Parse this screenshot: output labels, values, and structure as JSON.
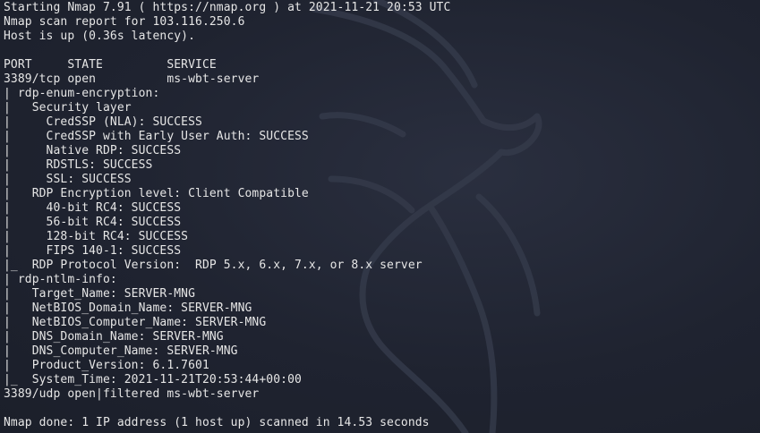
{
  "terminal": {
    "lines": [
      "Starting Nmap 7.91 ( https://nmap.org ) at 2021-11-21 20:53 UTC",
      "Nmap scan report for 103.116.250.6",
      "Host is up (0.36s latency).",
      "",
      "PORT     STATE         SERVICE",
      "3389/tcp open          ms-wbt-server",
      "| rdp-enum-encryption:",
      "|   Security layer",
      "|     CredSSP (NLA): SUCCESS",
      "|     CredSSP with Early User Auth: SUCCESS",
      "|     Native RDP: SUCCESS",
      "|     RDSTLS: SUCCESS",
      "|     SSL: SUCCESS",
      "|   RDP Encryption level: Client Compatible",
      "|     40-bit RC4: SUCCESS",
      "|     56-bit RC4: SUCCESS",
      "|     128-bit RC4: SUCCESS",
      "|     FIPS 140-1: SUCCESS",
      "|_  RDP Protocol Version:  RDP 5.x, 6.x, 7.x, or 8.x server",
      "| rdp-ntlm-info:",
      "|   Target_Name: SERVER-MNG",
      "|   NetBIOS_Domain_Name: SERVER-MNG",
      "|   NetBIOS_Computer_Name: SERVER-MNG",
      "|   DNS_Domain_Name: SERVER-MNG",
      "|   DNS_Computer_Name: SERVER-MNG",
      "|   Product_Version: 6.1.7601",
      "|_  System_Time: 2021-11-21T20:53:44+00:00",
      "3389/udp open|filtered ms-wbt-server",
      "",
      "Nmap done: 1 IP address (1 host up) scanned in 14.53 seconds"
    ]
  },
  "colors": {
    "background": "#1f2330",
    "text": "#e6e6e6",
    "logo": "#3a4152"
  },
  "icons": {
    "background_logo": "kali-dragon-icon"
  }
}
